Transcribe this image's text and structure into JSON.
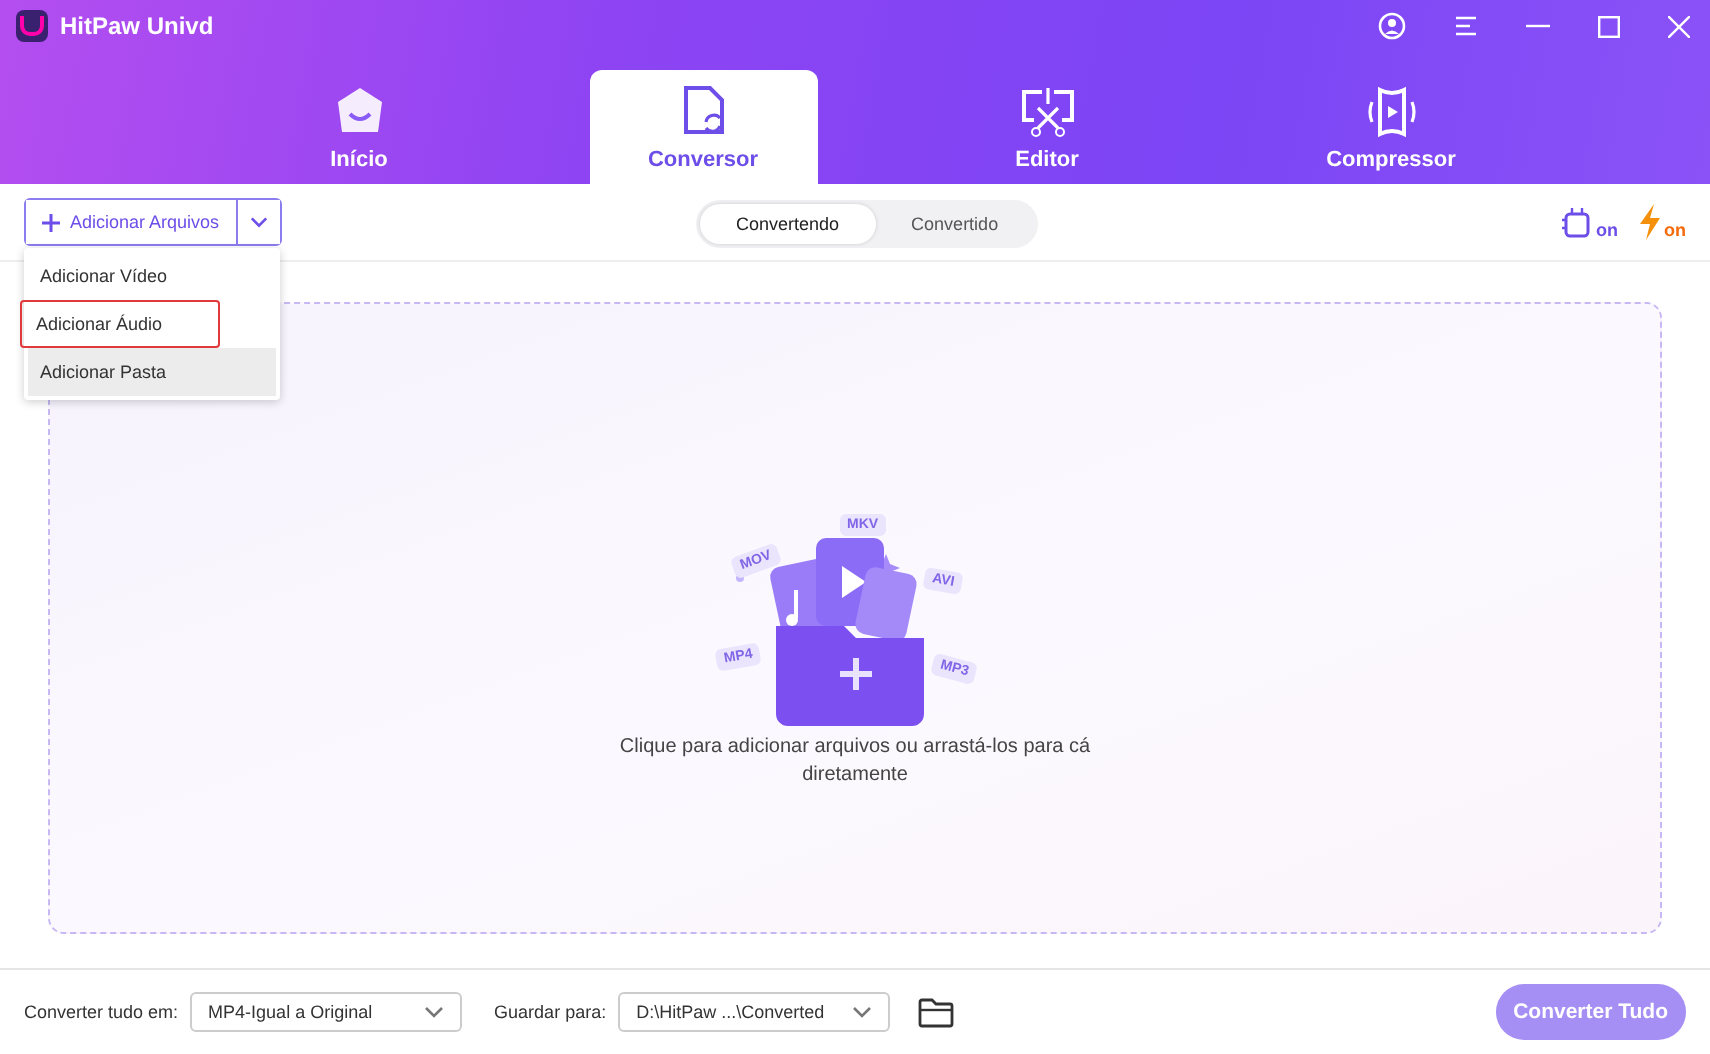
{
  "window": {
    "title": "HitPaw Univd"
  },
  "tabs": [
    {
      "label": "Início",
      "kind": "home",
      "selected": false
    },
    {
      "label": "Conversor",
      "kind": "convert",
      "selected": true
    },
    {
      "label": "Editor",
      "kind": "edit",
      "selected": false
    },
    {
      "label": "Compressor",
      "kind": "compress",
      "selected": false
    }
  ],
  "add_button": {
    "label": "Adicionar Arquivos"
  },
  "add_menu": [
    {
      "label": "Adicionar Vídeo",
      "highlighted": false,
      "hovered": false
    },
    {
      "label": "Adicionar Áudio",
      "highlighted": true,
      "hovered": false
    },
    {
      "label": "Adicionar Pasta",
      "highlighted": false,
      "hovered": true
    }
  ],
  "segments": [
    {
      "label": "Convertendo",
      "selected": true
    },
    {
      "label": "Convertido",
      "selected": false
    }
  ],
  "toolbar_badges": [
    {
      "kind": "chip",
      "label": "on"
    },
    {
      "kind": "bolt",
      "label": "on"
    }
  ],
  "drop_zone": {
    "tags": [
      "MOV",
      "MKV",
      "AVI",
      "MP4",
      "MP3"
    ],
    "message": "Clique para adicionar arquivos ou arrastá-los para cá diretamente"
  },
  "footer": {
    "format_label": "Converter tudo em:",
    "format_value": "MP4-Igual a Original",
    "save_label": "Guardar para:",
    "save_value": "D:\\HitPaw ...\\Converted",
    "convert_button": "Converter Tudo",
    "convert_disabled": true
  }
}
